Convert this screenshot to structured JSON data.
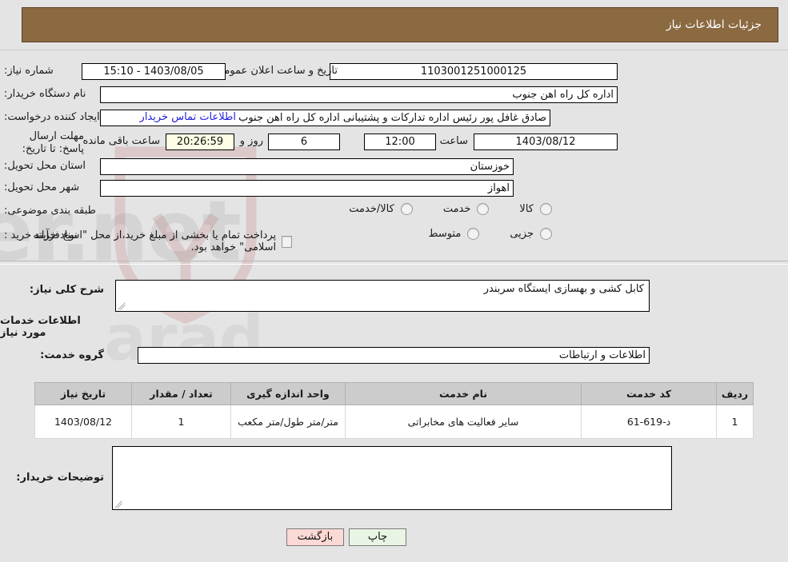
{
  "header": {
    "title": "جزئیات اطلاعات نیاز",
    "bg": "#8b6a42",
    "fg": "#ffffff"
  },
  "form": {
    "need_number_label": "شماره نیاز:",
    "need_number_value": "1103001251000125",
    "announce_datetime_label": "تاریخ و ساعت اعلان عمومی:",
    "announce_datetime_value": "1403/08/05 - 15:10",
    "buyer_org_label": "نام دستگاه خریدار:",
    "buyer_org_value": "اداره کل راه اهن جنوب",
    "creator_label": "ایجاد کننده درخواست:",
    "creator_value": "صادق غافل پور رئیس اداره تدارکات و پشتیبانی اداره کل راه اهن جنوب",
    "contact_link": "اطلاعات تماس خریدار",
    "deadline_label": "مهلت ارسال پاسخ: تا تاریخ:",
    "deadline_date": "1403/08/12",
    "hour_label": "ساعت",
    "deadline_time": "12:00",
    "days_value": "6",
    "days_label": "روز و",
    "remaining_clock": "20:26:59",
    "remaining_label": "ساعت باقی مانده",
    "province_label": "استان محل تحویل:",
    "province_value": "خوزستان",
    "city_label": "شهر محل تحویل:",
    "city_value": "اهواز",
    "category_label": "طبقه بندی موضوعی:",
    "category_options": [
      "کالا",
      "خدمت",
      "کالا/خدمت"
    ],
    "process_label": "نوع فرآیند خرید :",
    "process_options": [
      "جزیی",
      "متوسط"
    ],
    "treasury_note": "پرداخت تمام یا بخشی از مبلغ خرید،از محل \"اسناد خزانه اسلامی\" خواهد بود."
  },
  "body": {
    "summary_label": "شرح کلی نیاز:",
    "summary_value": "کابل کشی و بهسازی ایستگاه سربندر",
    "services_heading": "اطلاعات خدمات مورد نیاز",
    "service_group_label": "گروه خدمت:",
    "service_group_value": "اطلاعات و ارتباطات",
    "remarks_label": "توضیحات خریدار:",
    "remarks_value": ""
  },
  "table": {
    "columns": [
      "ردیف",
      "کد خدمت",
      "نام خدمت",
      "واحد اندازه گیری",
      "تعداد / مقدار",
      "تاریخ نیاز"
    ],
    "rows": [
      {
        "index": "1",
        "code": "د-619-61",
        "name": "سایر فعالیت های مخابراتی",
        "unit": "متر/متر طول/متر مکعب",
        "quantity": "1",
        "need_date": "1403/08/12"
      }
    ]
  },
  "buttons": {
    "print": "چاپ",
    "back": "بازگشت"
  },
  "watermark": {
    "text": "AnaTender.net"
  }
}
